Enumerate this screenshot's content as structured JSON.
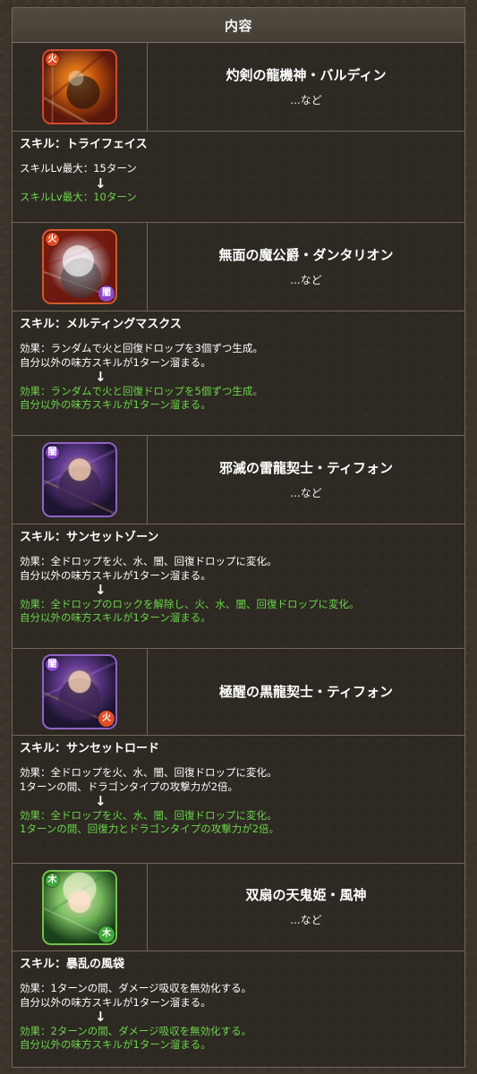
{
  "header": {
    "title": "内容"
  },
  "items": [
    {
      "name": "灼剣の龍機神・バルディン",
      "note": "...など",
      "skill": "スキル：トライフェイス",
      "before": [
        "スキルLv最大：15ターン"
      ],
      "arrow": "↓",
      "after": [
        "スキルLv最大：10ターン"
      ],
      "icon": {
        "main_attr": "火",
        "sub_attr": ""
      }
    },
    {
      "name": "無面の魔公爵・ダンタリオン",
      "note": "...など",
      "skill": "スキル：メルティングマスクス",
      "before": [
        "効果：ランダムで火と回復ドロップを3個ずつ生成。",
        "自分以外の味方スキルが1ターン溜まる。"
      ],
      "arrow": "↓",
      "after": [
        "効果：ランダムで火と回復ドロップを5個ずつ生成。",
        "自分以外の味方スキルが1ターン溜まる。"
      ],
      "icon": {
        "main_attr": "火",
        "sub_attr": "闇"
      }
    },
    {
      "name": "邪滅の雷龍契士・ティフォン",
      "note": "...など",
      "skill": "スキル：サンセットゾーン",
      "before": [
        "効果：全ドロップを火、水、闇、回復ドロップに変化。",
        "自分以外の味方スキルが1ターン溜まる。"
      ],
      "arrow": "↓",
      "after": [
        "効果：全ドロップのロックを解除し、火、水、闇、回復ドロップに変化。",
        "自分以外の味方スキルが1ターン溜まる。"
      ],
      "icon": {
        "main_attr": "闇",
        "sub_attr": ""
      }
    },
    {
      "name": "極醒の黒龍契士・ティフォン",
      "note": "",
      "skill": "スキル：サンセットロード",
      "before": [
        "効果：全ドロップを火、水、闇、回復ドロップに変化。",
        "1ターンの間、ドラゴンタイプの攻撃力が2倍。"
      ],
      "arrow": "↓",
      "after": [
        "効果：全ドロップを火、水、闇、回復ドロップに変化。",
        "1ターンの間、回復力とドラゴンタイプの攻撃力が2倍。"
      ],
      "icon": {
        "main_attr": "闇",
        "sub_attr": "火"
      }
    },
    {
      "name": "双扇の天鬼姫・風神",
      "note": "...など",
      "skill": "スキル：暴乱の風袋",
      "before": [
        "効果：1ターンの間、ダメージ吸収を無効化する。",
        "自分以外の味方スキルが1ターン溜まる。"
      ],
      "arrow": "↓",
      "after": [
        "効果：2ターンの間、ダメージ吸収を無効化する。",
        "自分以外の味方スキルが1ターン溜まる。"
      ],
      "icon": {
        "main_attr": "木",
        "sub_attr": "木"
      }
    }
  ]
}
